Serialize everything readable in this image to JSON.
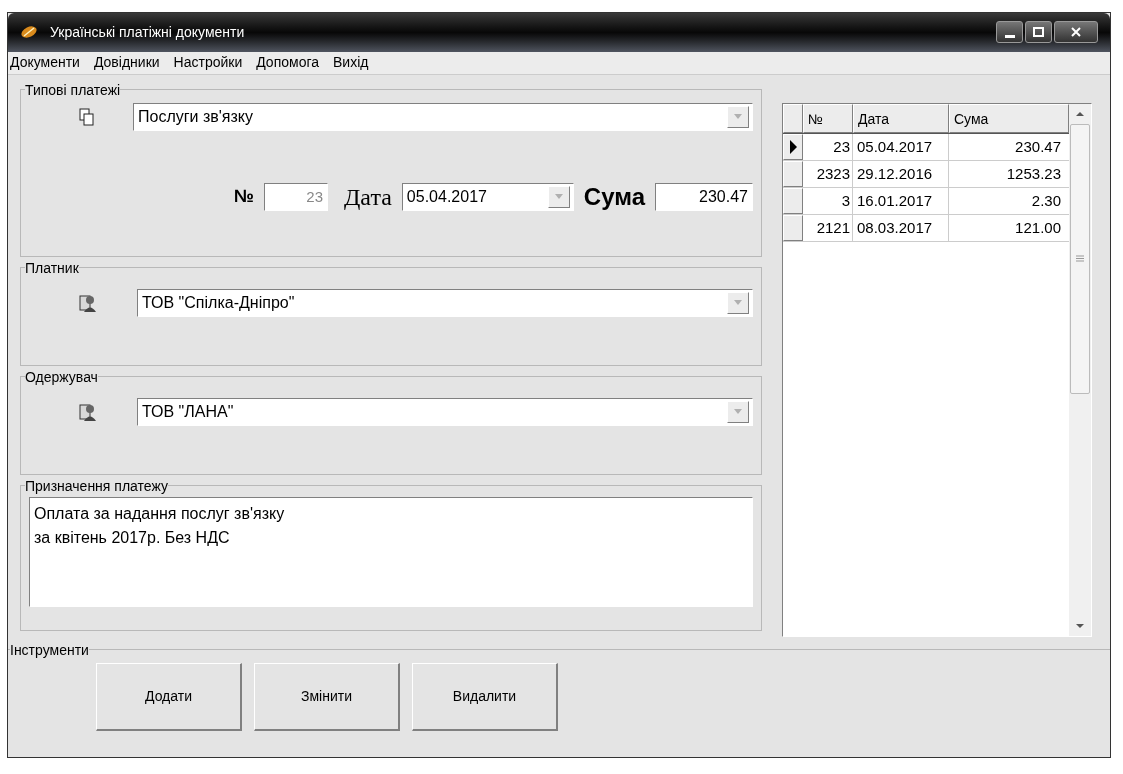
{
  "window": {
    "title": "Українські платіжні документи"
  },
  "menu": [
    "Документи",
    "Довідники",
    "Настройки",
    "Допомога",
    "Вихід"
  ],
  "typical_payments": {
    "label": "Типові платежі",
    "value": "Послуги зв'язку",
    "number_label": "№",
    "number": "23",
    "date_label": "Дата",
    "date": "05.04.2017",
    "sum_label": "Сума",
    "sum": "230.47"
  },
  "payer": {
    "label": "Платник",
    "value": "ТОВ \"Спілка-Дніпро\""
  },
  "recipient": {
    "label": "Одержувач",
    "value": "ТОВ \"ЛАНА\""
  },
  "purpose": {
    "label": "Призначення платежу",
    "value": "Оплата за надання послуг зв'язку\nза квітень 2017р. Без НДС"
  },
  "table": {
    "columns": [
      "№",
      "Дата",
      "Сума"
    ],
    "rows": [
      {
        "number": "23",
        "date": "05.04.2017",
        "sum": "230.47",
        "selected": true
      },
      {
        "number": "2323",
        "date": "29.12.2016",
        "sum": "1253.23",
        "selected": false
      },
      {
        "number": "3",
        "date": "16.01.2017",
        "sum": "2.30",
        "selected": false
      },
      {
        "number": "2121",
        "date": "08.03.2017",
        "sum": "121.00",
        "selected": false
      }
    ]
  },
  "tools": {
    "label": "Інструменти",
    "buttons": [
      "Додати",
      "Змінити",
      "Видалити"
    ]
  }
}
